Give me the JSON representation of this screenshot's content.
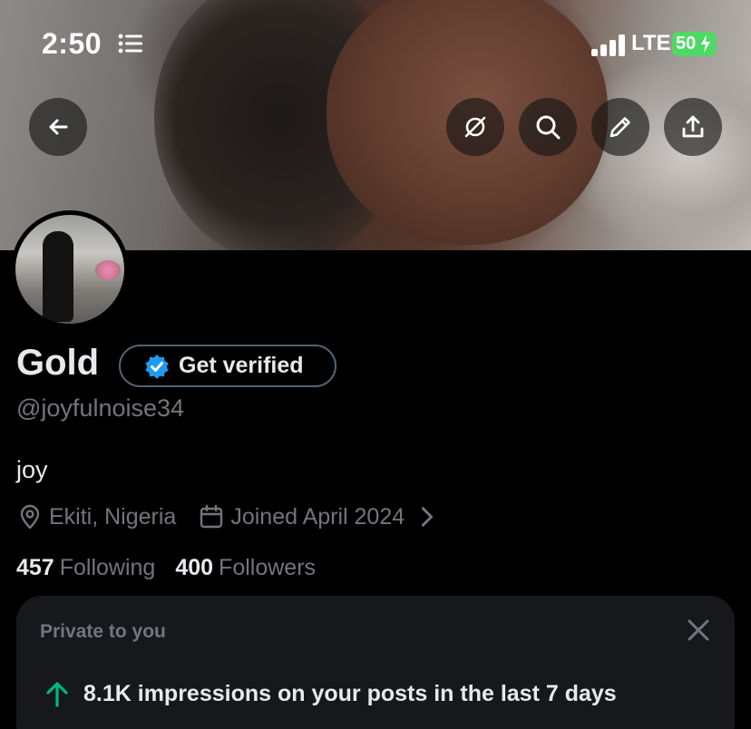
{
  "status_bar": {
    "time": "2:50",
    "network": "LTE",
    "battery": "50"
  },
  "profile": {
    "name": "Gold",
    "verify_label": "Get verified",
    "handle": "@joyfulnoise34",
    "bio": "joy",
    "location": "Ekiti, Nigeria",
    "joined": "Joined April 2024",
    "following_count": "457",
    "following_label": "Following",
    "followers_count": "400",
    "followers_label": "Followers"
  },
  "insights_card": {
    "title": "Private to you",
    "stat": "8.1K impressions on your posts in the last 7 days"
  },
  "colors": {
    "verified_blue": "#1d9bf0",
    "trend_green": "#00ba7c",
    "battery_green": "#4fd964",
    "muted_text": "#71767b"
  },
  "icons": {
    "back": "back-arrow-icon",
    "grok": "grok-icon",
    "search": "search-icon",
    "edit": "pencil-icon",
    "share": "share-icon",
    "location": "location-pin-icon",
    "calendar": "calendar-icon",
    "close": "close-icon",
    "trend": "arrow-up-icon"
  }
}
